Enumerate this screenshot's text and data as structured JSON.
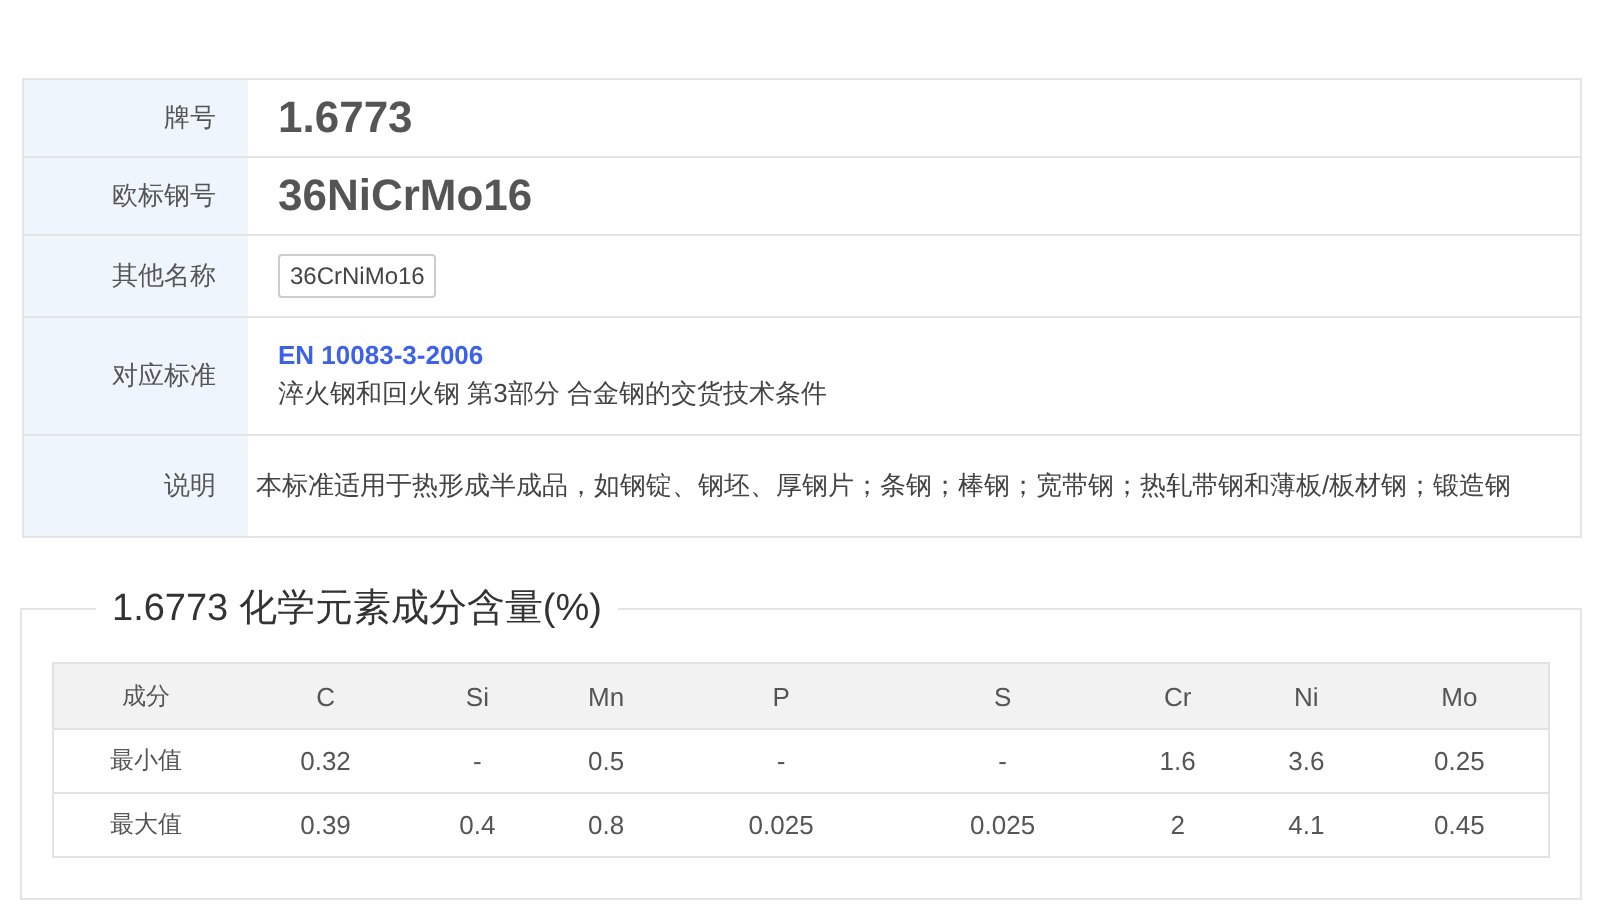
{
  "info": [
    {
      "label": "牌号",
      "kind": "big",
      "value": "1.6773"
    },
    {
      "label": "欧标钢号",
      "kind": "big",
      "value": "36NiCrMo16"
    },
    {
      "label": "其他名称",
      "kind": "tags",
      "tags": [
        "36CrNiMo16"
      ]
    },
    {
      "label": "对应标准",
      "kind": "standard",
      "code": "EN 10083-3-2006",
      "title": "淬火钢和回火钢 第3部分 合金钢的交货技术条件"
    },
    {
      "label": "说明",
      "kind": "text",
      "value": "本标准适用于热形成半成品，如钢锭、钢坯、厚钢片；条钢；棒钢；宽带钢；热轧带钢和薄板/板材钢；锻造钢"
    }
  ],
  "composition": {
    "title": "1.6773 化学元素成分含量(%)",
    "columns": [
      "成分",
      "C",
      "Si",
      "Mn",
      "P",
      "S",
      "Cr",
      "Ni",
      "Mo"
    ],
    "rows": [
      [
        "最小值",
        "0.32",
        "-",
        "0.5",
        "-",
        "-",
        "1.6",
        "3.6",
        "0.25"
      ],
      [
        "最大值",
        "0.39",
        "0.4",
        "0.8",
        "0.025",
        "0.025",
        "2",
        "4.1",
        "0.45"
      ]
    ]
  }
}
